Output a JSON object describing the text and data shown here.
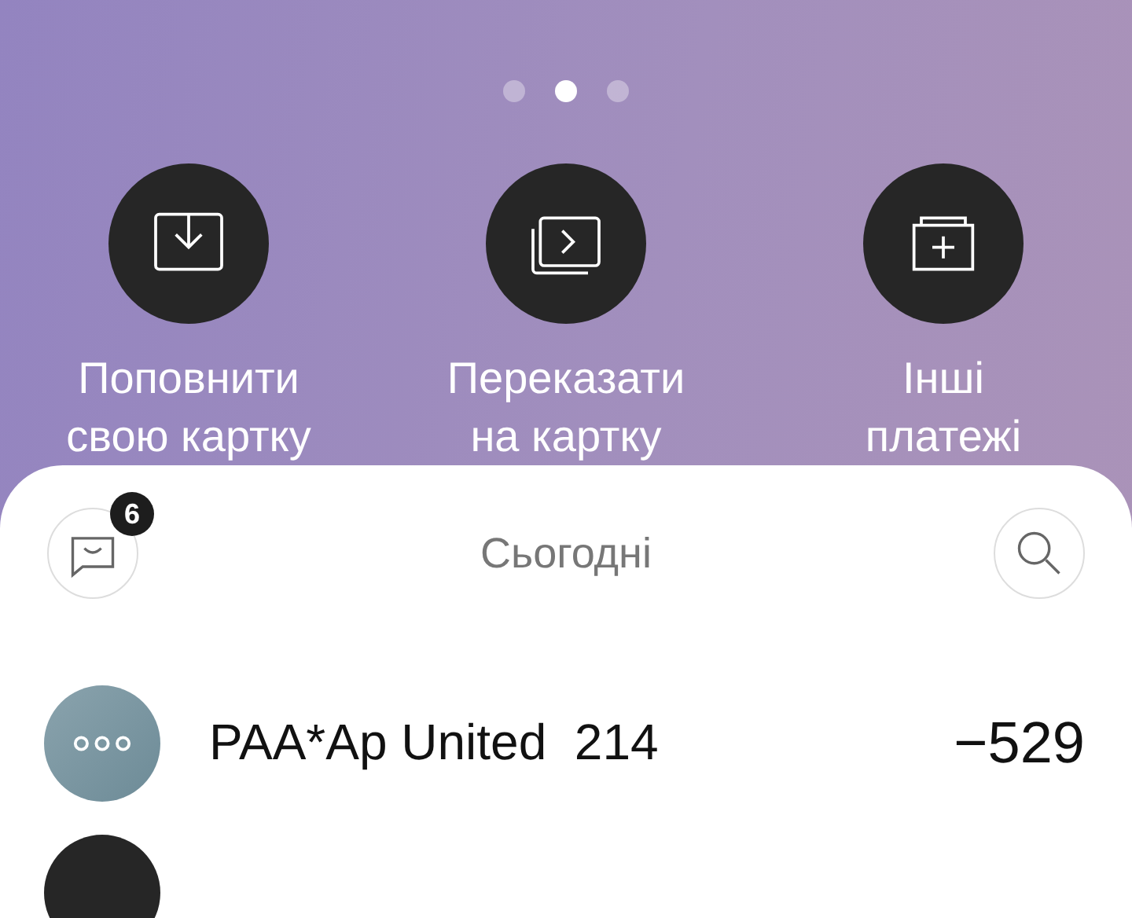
{
  "pager": [
    {
      "selected": false
    },
    {
      "selected": true
    },
    {
      "selected": false
    }
  ],
  "actions": [
    {
      "kind": "topup",
      "label": "Поповнити\nсвою картку"
    },
    {
      "kind": "transfer",
      "label": "Переказати\nна картку"
    },
    {
      "kind": "other",
      "label": "Інші\nплатежі"
    }
  ],
  "feed": {
    "title": "Сьогодні",
    "messages_badge": "6"
  },
  "transactions": [
    {
      "kind": "dots",
      "name": "PAA*Ap United  214",
      "amount": "−529"
    },
    {
      "kind": "dark"
    }
  ]
}
